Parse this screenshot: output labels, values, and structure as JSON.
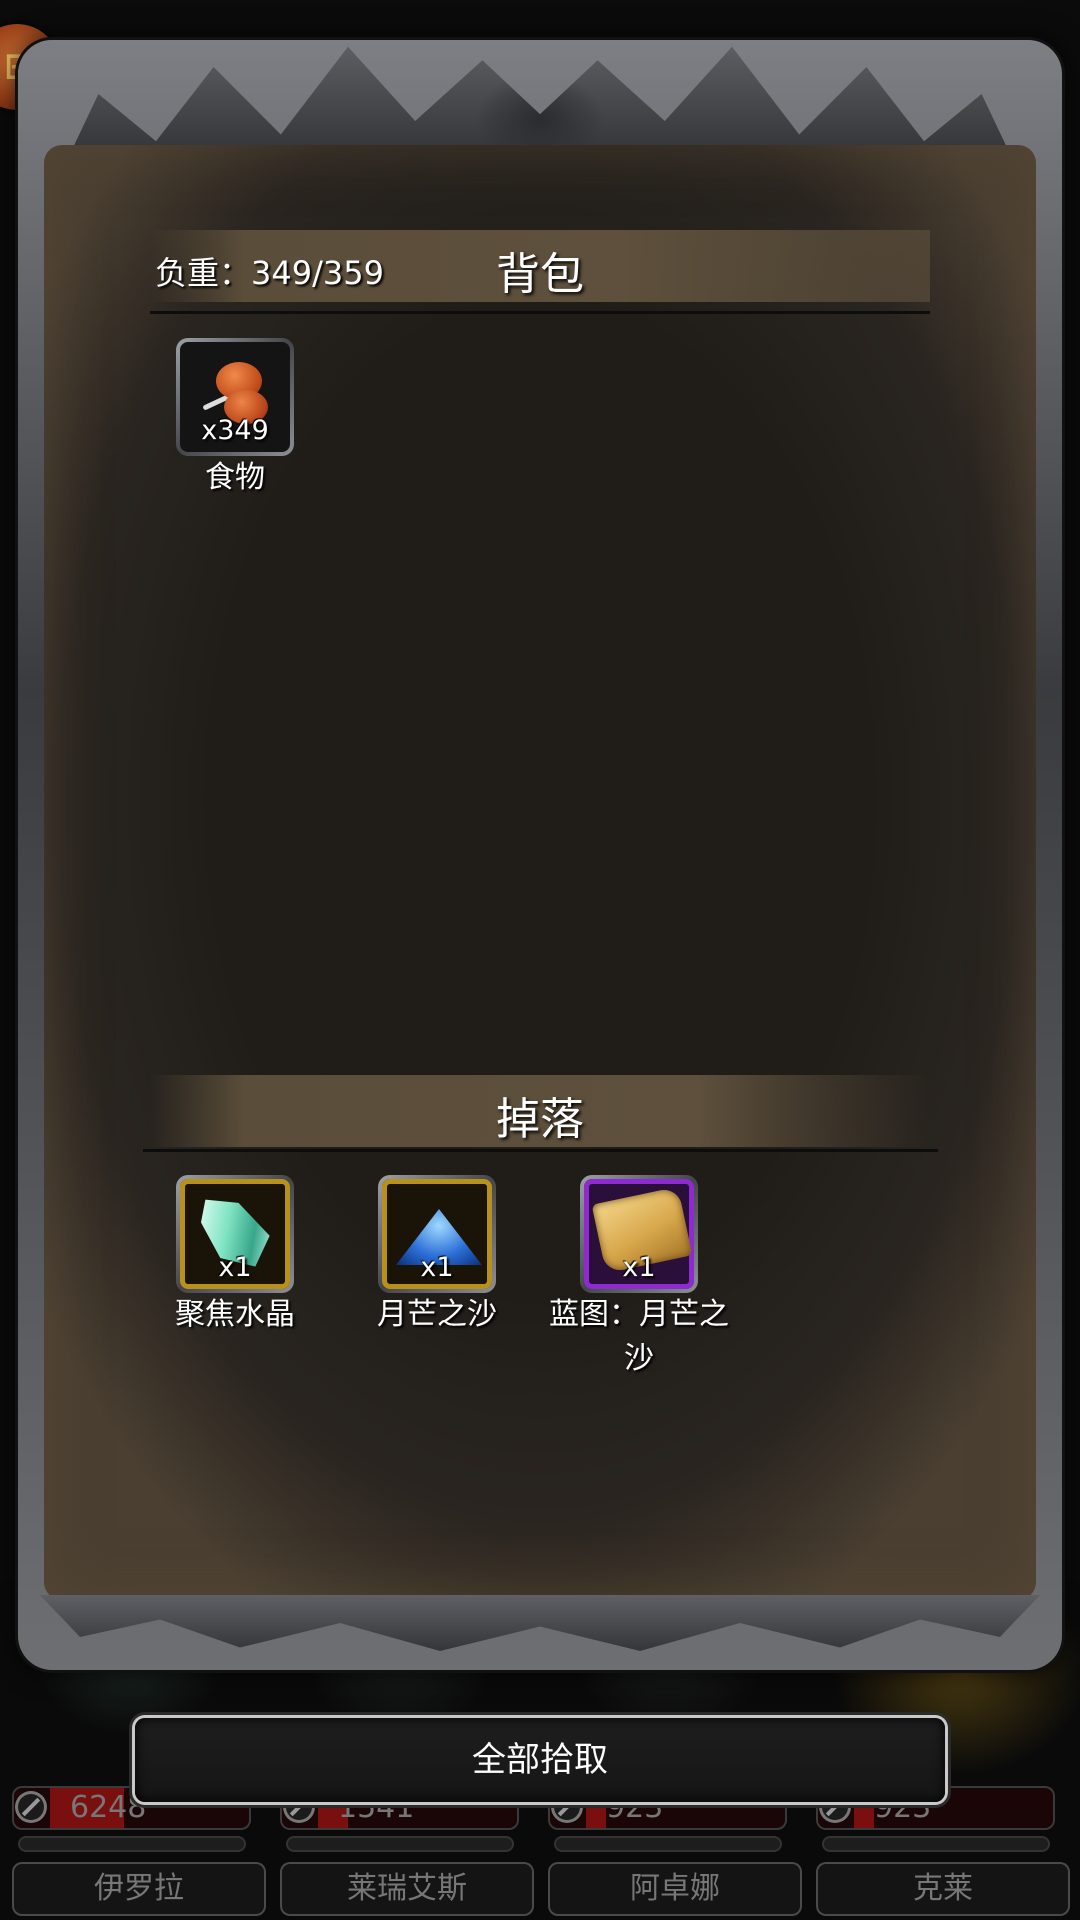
{
  "header": {
    "weight_text": "负重：349/359",
    "title": "背包"
  },
  "inventory": [
    {
      "icon": "meat-icon",
      "count": "x349",
      "name": "食物"
    }
  ],
  "drops": {
    "title": "掉落",
    "items": [
      {
        "icon": "crystal-icon",
        "count": "x1",
        "name": "聚焦水晶",
        "rarity_color": "#b8911d"
      },
      {
        "icon": "moon-sand-icon",
        "count": "x1",
        "name": "月芒之沙",
        "rarity_color": "#b8911d"
      },
      {
        "icon": "scroll-icon",
        "count": "x1",
        "name": "蓝图：月芒之沙",
        "rarity_color": "#8e2bd0"
      }
    ]
  },
  "pick_all_label": "全部拾取",
  "party": [
    {
      "hp": "6248",
      "hp_fraction": 0.3,
      "name": "伊罗拉"
    },
    {
      "hp": "1541",
      "hp_fraction": 0.15,
      "name": "莱瑞艾斯"
    },
    {
      "hp": "923",
      "hp_fraction": 0.1,
      "name": "阿卓娜"
    },
    {
      "hp": "923",
      "hp_fraction": 0.1,
      "name": "克莱"
    }
  ],
  "colors": {
    "accent_gold": "#b8911d",
    "accent_purple": "#8e2bd0",
    "hp_red": "#7a0f0f"
  }
}
